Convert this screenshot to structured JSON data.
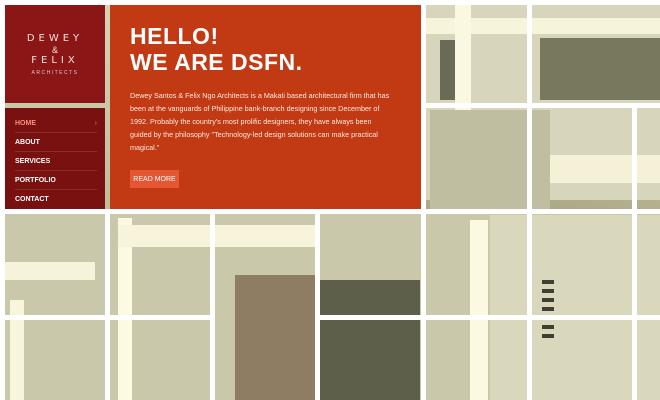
{
  "logo": {
    "line1": "DEWEY",
    "amp": "&",
    "line2": "FELIX",
    "sub": "ARCHITECTS"
  },
  "nav": {
    "items": [
      {
        "label": "HOME",
        "arrow": "›"
      },
      {
        "label": "ABOUT",
        "arrow": ""
      },
      {
        "label": "SERVICES",
        "arrow": ""
      },
      {
        "label": "PORTFOLIO",
        "arrow": ""
      },
      {
        "label": "CONTACT",
        "arrow": ""
      }
    ],
    "active_index": 0
  },
  "hero": {
    "title1": "HELLO!",
    "title2": "WE ARE DSFN.",
    "text": "Dewey Santos & Felix Ngo Architects is a Makati based architectural firm that has been at the vanguards of Philippine bank-branch designing since December of 1992. Probably the country's most prolific designers, they have always been guided by the philosophy \"Technology-led design solutions can make practical magical.\"",
    "button": "READ MORE"
  },
  "colors": {
    "logo_bg": "#8b1616",
    "nav_bg": "#7a1111",
    "hero_bg": "#c23a13",
    "button_bg": "#e65633",
    "active_nav": "#ff8f7d"
  }
}
